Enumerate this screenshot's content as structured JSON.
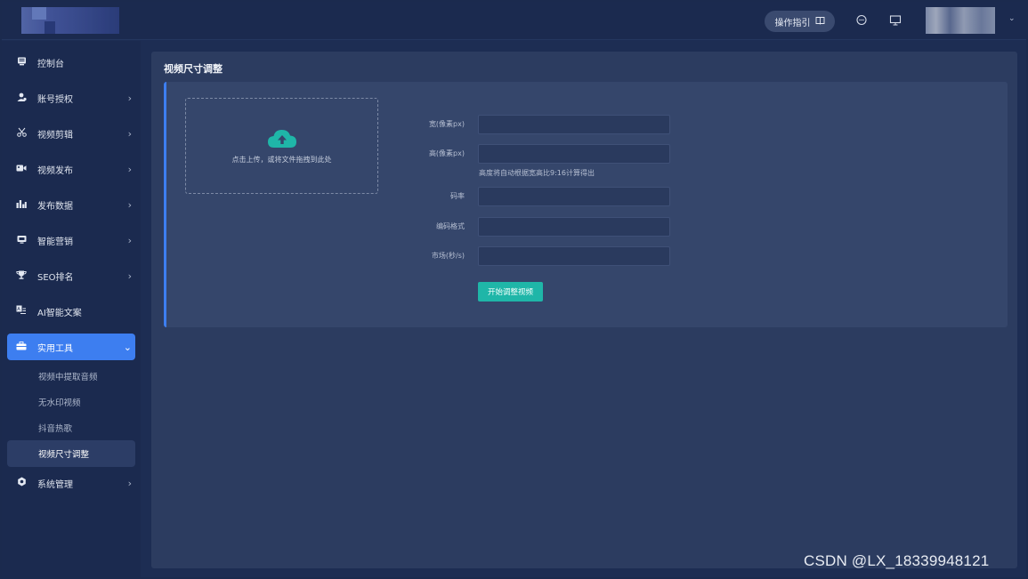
{
  "header": {
    "guide_label": "操作指引",
    "guide_icon": "book-icon",
    "icons": [
      "chat-icon",
      "monitor-icon"
    ]
  },
  "sidebar": {
    "items": [
      {
        "label": "控制台",
        "icon": "dashboard-icon",
        "has_children": false
      },
      {
        "label": "账号授权",
        "icon": "user-auth-icon",
        "has_children": true
      },
      {
        "label": "视频剪辑",
        "icon": "scissors-icon",
        "has_children": true
      },
      {
        "label": "视频发布",
        "icon": "video-camera-icon",
        "has_children": true
      },
      {
        "label": "发布数据",
        "icon": "bar-chart-icon",
        "has_children": true
      },
      {
        "label": "智能营销",
        "icon": "marketing-icon",
        "has_children": true
      },
      {
        "label": "SEO排名",
        "icon": "trophy-icon",
        "has_children": true
      },
      {
        "label": "AI智能文案",
        "icon": "ai-doc-icon",
        "has_children": false
      },
      {
        "label": "实用工具",
        "icon": "toolbox-icon",
        "has_children": true,
        "expanded": true
      },
      {
        "label": "系统管理",
        "icon": "settings-icon",
        "has_children": true
      }
    ],
    "sub_items": [
      "视频中提取音频",
      "无水印视频",
      "抖音热歌",
      "视频尺寸调整"
    ],
    "current_sub": "视频尺寸调整"
  },
  "main": {
    "page_title": "视频尺寸调整",
    "upload_text": "点击上传，或将文件拖拽到此处",
    "fields": [
      {
        "label": "宽(像素px)",
        "value": ""
      },
      {
        "label": "高(像素px)",
        "value": ""
      },
      {
        "label": "码率",
        "value": ""
      },
      {
        "label": "编码格式",
        "value": ""
      },
      {
        "label": "市场(秒/s)",
        "value": ""
      }
    ],
    "hint": "高度将自动根据宽高比9:16计算得出",
    "submit_label": "开始调整视频"
  },
  "watermark": "CSDN @LX_18339948121",
  "colors": {
    "accent": "#3d7ef0",
    "button": "#1fb6a8",
    "sidebar_bg": "#1b2a4f",
    "panel_bg": "#2c3c60"
  }
}
